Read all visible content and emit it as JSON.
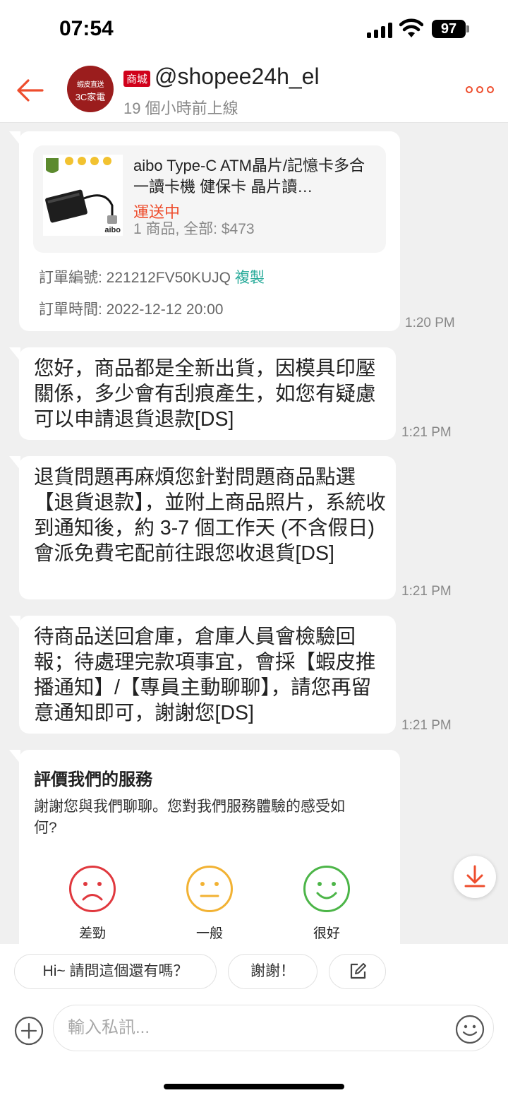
{
  "status_bar": {
    "time": "07:54",
    "battery": "97"
  },
  "header": {
    "shop_logo_line1": "蝦皮直送",
    "shop_logo_line2": "3C家電",
    "mall_badge": "商城",
    "shop_name": "@shopee24h_el",
    "last_seen": "19 個小時前上線"
  },
  "messages": [
    {
      "type": "order",
      "product_name": "aibo Type-C ATM晶片/記憶卡多合一讀卡機 健保卡 晶片讀…",
      "status": "運送中",
      "summary": "1 商品, 全部: $473",
      "order_no_label": "訂單編號: 221212FV50KUJQ",
      "copy_label": "複製",
      "order_time_label": "訂單時間: 2022-12-12 20:00",
      "time": "1:20 PM",
      "thumb_brand": "aibo"
    },
    {
      "type": "text",
      "text": "您好，商品都是全新出貨，因模具印壓關係，多少會有刮痕產生，如您有疑慮可以申請退貨退款[DS]",
      "time": "1:21 PM"
    },
    {
      "type": "text",
      "text": "退貨問題再麻煩您針對問題商品點選【退貨退款】，並附上商品照片，系統收到通知後，約 3-7 個工作天 (不含假日) 會派免費宅配前往跟您收退貨[DS]",
      "time": "1:21 PM"
    },
    {
      "type": "text",
      "text": "待商品送回倉庫，倉庫人員會檢驗回報；待處理完款項事宜，會採【蝦皮推播通知】/【專員主動聊聊】，請您再留意通知即可，謝謝您[DS]",
      "time": "1:21 PM"
    }
  ],
  "rating": {
    "title": "評價我們的服務",
    "description": "謝謝您與我們聊聊。您對我們服務體驗的感受如何?",
    "options": [
      {
        "label": "差勁",
        "color": "#e0383e"
      },
      {
        "label": "一般",
        "color": "#f2b233"
      },
      {
        "label": "很好",
        "color": "#4cb548"
      }
    ]
  },
  "quick_replies": [
    "Hi~ 請問這個還有嗎？",
    "謝謝！"
  ],
  "input": {
    "placeholder": "輸入私訊..."
  },
  "colors": {
    "accent": "#ee4d2d",
    "copy_link": "#26aa99"
  }
}
